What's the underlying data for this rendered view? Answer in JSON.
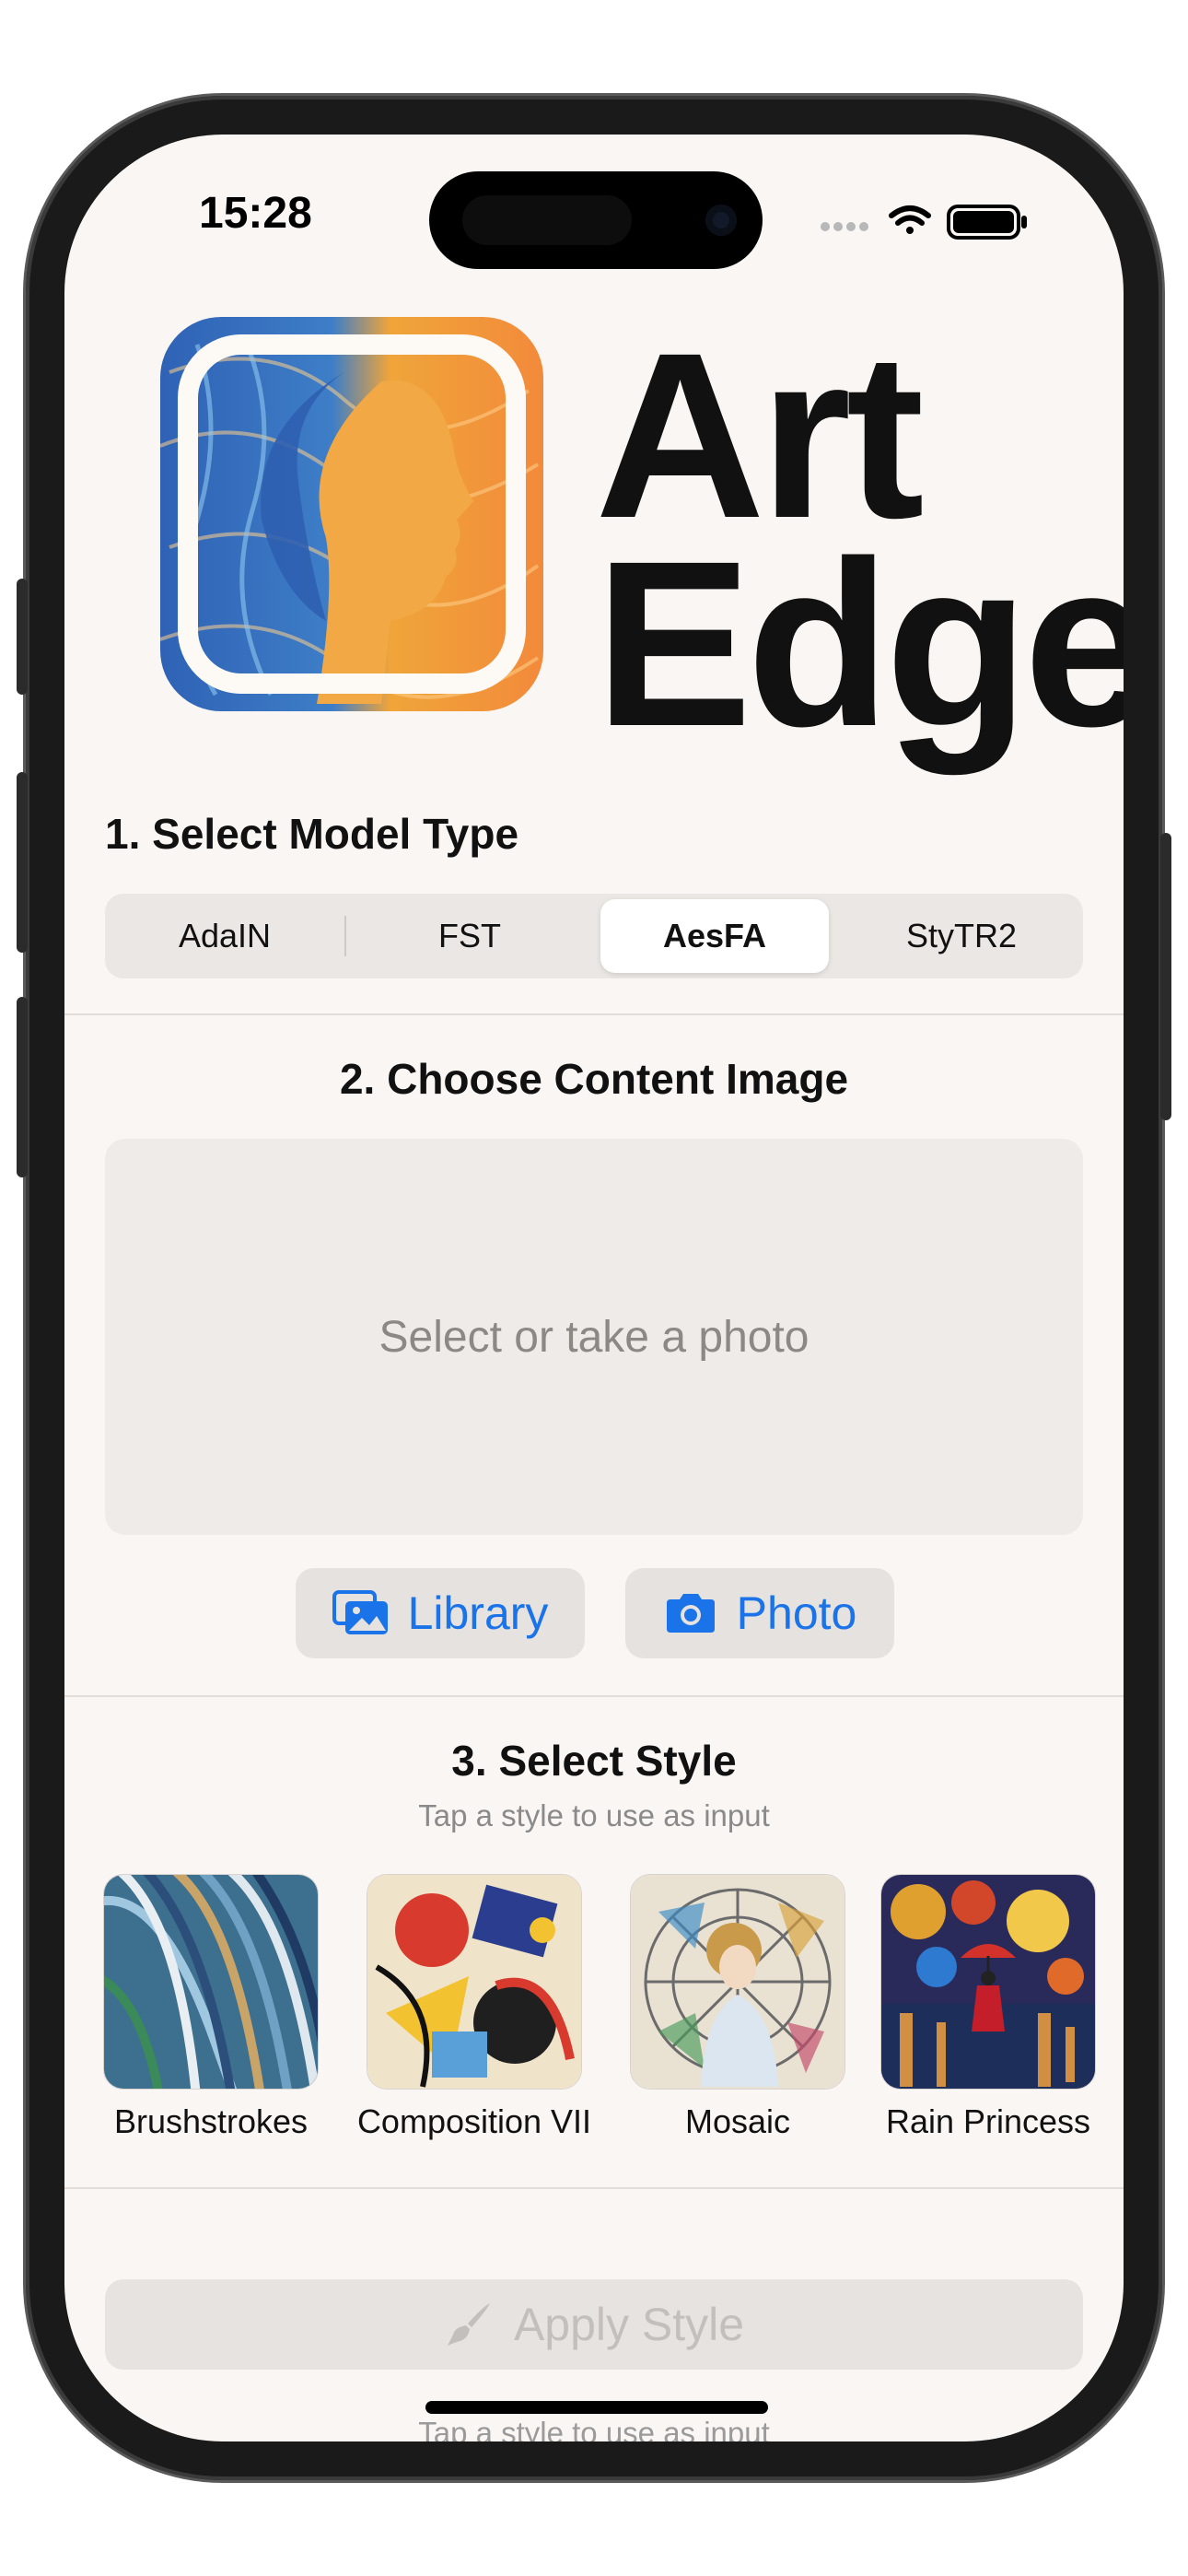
{
  "status_bar": {
    "time": "15:28"
  },
  "brand": {
    "line1": "Art",
    "line2": "Edge"
  },
  "sections": {
    "model": {
      "heading": "1. Select Model Type",
      "options": [
        "AdaIN",
        "FST",
        "AesFA",
        "StyTR2"
      ],
      "selected": "AesFA"
    },
    "content": {
      "heading": "2. Choose Content Image",
      "placeholder": "Select or take a photo",
      "library_label": "Library",
      "photo_label": "Photo"
    },
    "style": {
      "heading": "3. Select Style",
      "subtitle": "Tap a style to use as input",
      "items": [
        "Brushstrokes",
        "Composition VII",
        "Mosaic",
        "Rain Princess"
      ]
    }
  },
  "apply": {
    "label": "Apply Style",
    "hint": "Tap a style to use as input"
  },
  "colors": {
    "accent": "#1a73e8",
    "background": "#faf6f3",
    "disabled": "#c3bfbc"
  },
  "icons": [
    "photo-library-icon",
    "camera-icon",
    "paintbrush-icon",
    "wifi-icon",
    "battery-icon",
    "signal-icon"
  ]
}
